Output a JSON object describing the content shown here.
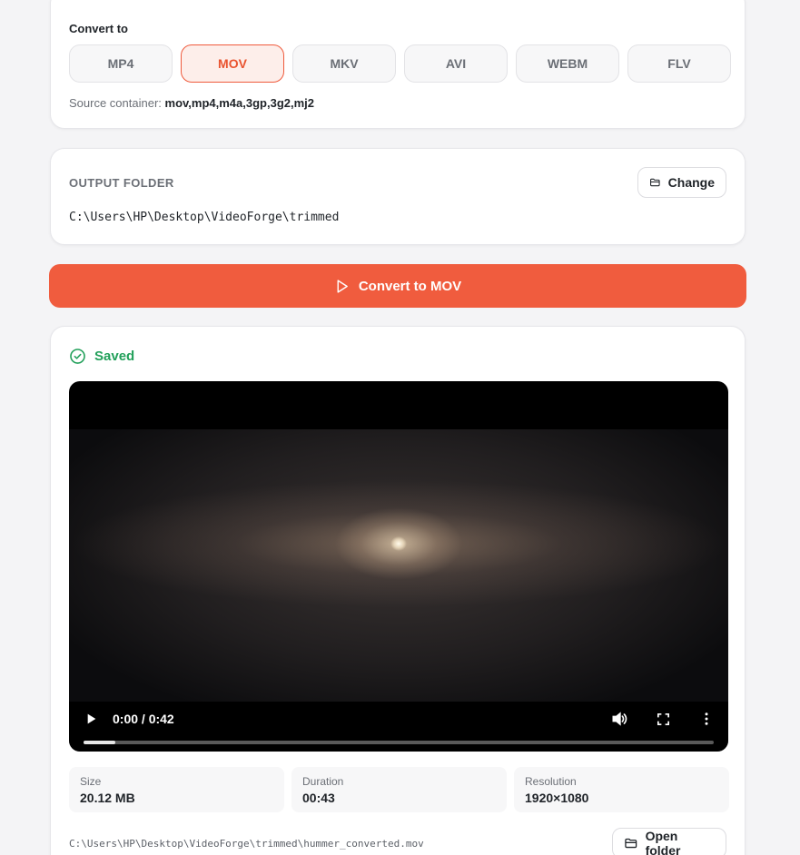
{
  "convert": {
    "label": "Convert to",
    "formats": [
      "MP4",
      "MOV",
      "MKV",
      "AVI",
      "WEBM",
      "FLV"
    ],
    "selected": "MOV",
    "source_label": "Source container:",
    "source_value": "mov,mp4,m4a,3gp,3g2,mj2"
  },
  "output": {
    "label": "OUTPUT FOLDER",
    "change_label": "Change",
    "path": "C:\\Users\\HP\\Desktop\\VideoForge\\trimmed"
  },
  "action": {
    "convert_label": "Convert to MOV"
  },
  "result": {
    "status": "Saved",
    "player": {
      "time": "0:00 / 0:42",
      "progress": 0.05
    },
    "stats": [
      {
        "label": "Size",
        "value": "20.12 MB"
      },
      {
        "label": "Duration",
        "value": "00:43"
      },
      {
        "label": "Resolution",
        "value": "1920×1080"
      }
    ],
    "file_path": "C:\\Users\\HP\\Desktop\\VideoForge\\trimmed\\hummer_converted.mov",
    "open_folder_label": "Open folder"
  },
  "colors": {
    "accent": "#f05c3e",
    "accent_soft": "#fdeeea",
    "success": "#22a05a"
  },
  "icons": [
    "folder-icon",
    "play-outline-icon",
    "check-circle-icon",
    "play-icon",
    "volume-icon",
    "fullscreen-icon",
    "more-vertical-icon"
  ]
}
